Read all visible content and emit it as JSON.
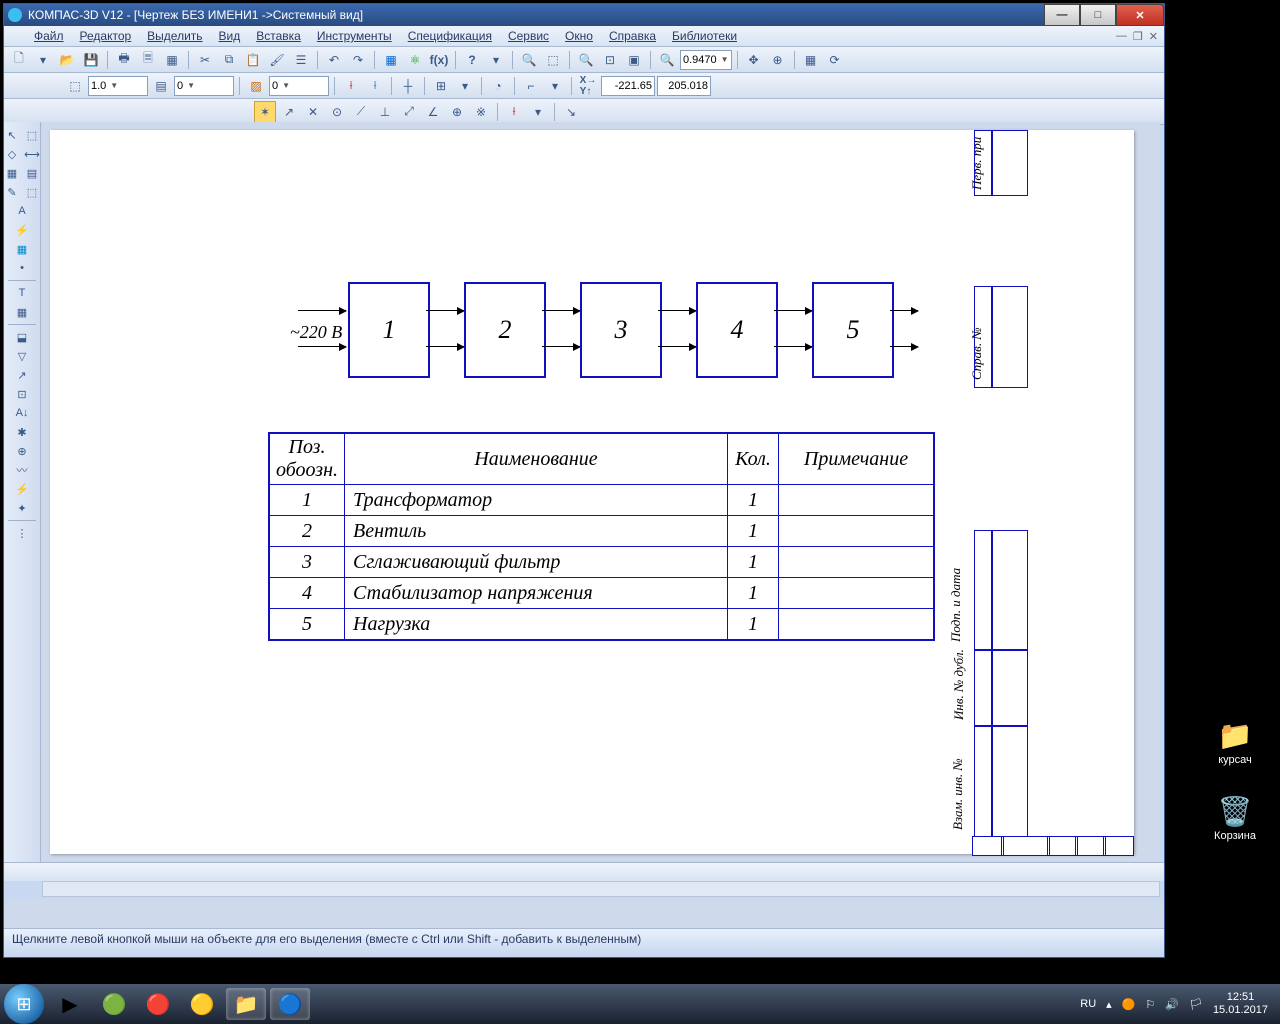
{
  "title": "КОМПАС-3D V12 - [Чертеж БЕЗ ИМЕНИ1 ->Системный вид]",
  "menu": [
    "Файл",
    "Редактор",
    "Выделить",
    "Вид",
    "Вставка",
    "Инструменты",
    "Спецификация",
    "Сервис",
    "Окно",
    "Справка",
    "Библиотеки"
  ],
  "tb2": {
    "scale": "1.0",
    "layer": "0",
    "style": "0"
  },
  "zoom": "0.9470",
  "coords": {
    "x": "-221.65",
    "y": "205.018"
  },
  "diagram": {
    "input": "~220 В",
    "blocks": [
      "1",
      "2",
      "3",
      "4",
      "5"
    ]
  },
  "table": {
    "headers": [
      "Поз. обоозн.",
      "Наименование",
      "Кол.",
      "Примечание"
    ],
    "rows": [
      {
        "pos": "1",
        "name": "Трансформатор",
        "qty": "1",
        "note": ""
      },
      {
        "pos": "2",
        "name": "Вентиль",
        "qty": "1",
        "note": ""
      },
      {
        "pos": "3",
        "name": "Сглаживающий фильтр",
        "qty": "1",
        "note": ""
      },
      {
        "pos": "4",
        "name": "Стабилизатор напряжения",
        "qty": "1",
        "note": ""
      },
      {
        "pos": "5",
        "name": "Нагрузка",
        "qty": "1",
        "note": ""
      }
    ]
  },
  "side_labels": [
    "Перв. при",
    "Справ. №",
    "Подп. и дата",
    "Инв. № дубл.",
    "Взам. инв. №"
  ],
  "status": "Щелкните левой кнопкой мыши на объекте для его выделения (вместе с Ctrl или Shift - добавить к выделенным)",
  "tray": {
    "lang": "RU",
    "time": "12:51",
    "date": "15.01.2017"
  },
  "desktop": {
    "folder": "курсач",
    "bin": "Корзина"
  }
}
